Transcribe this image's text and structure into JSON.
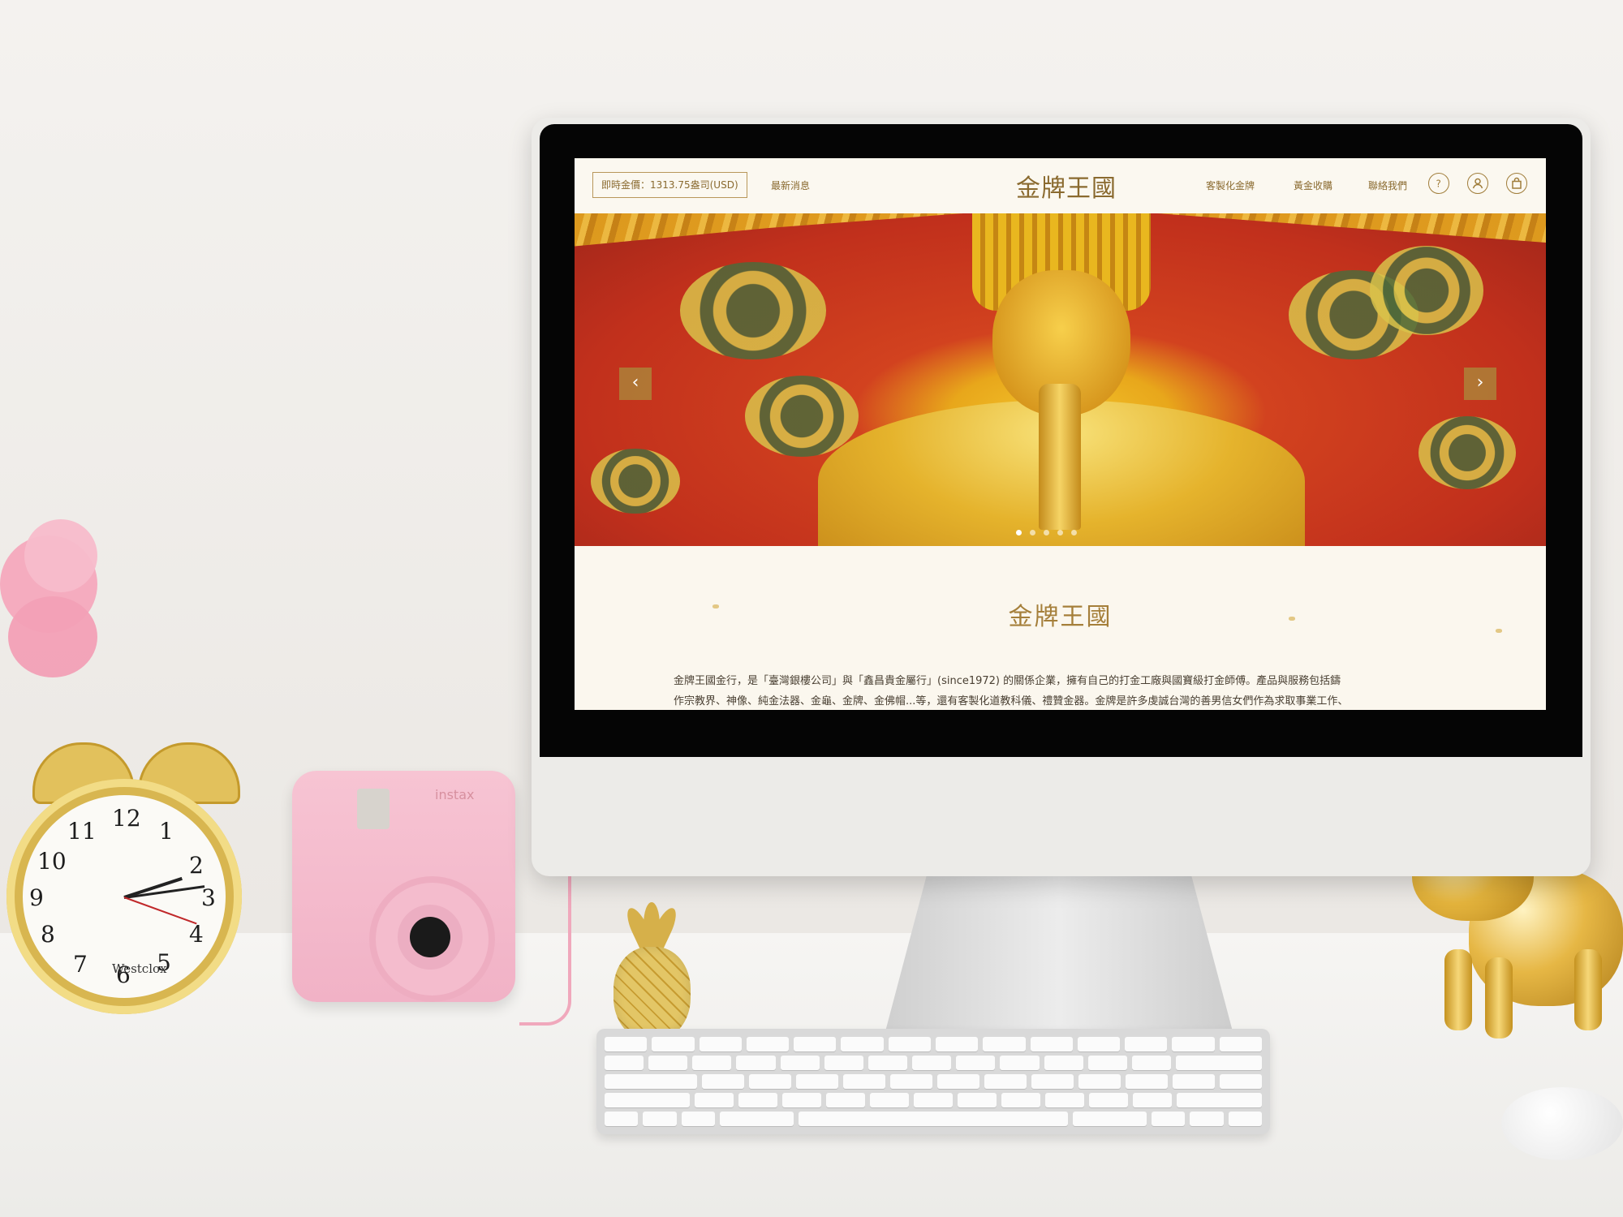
{
  "site": {
    "gold_price_label": "即時金價：1313.75盎司(USD)",
    "nav_left": [
      "最新消息"
    ],
    "logo_text": "金牌王國",
    "nav_right": [
      "客製化金牌",
      "黃金收購",
      "聯絡我們"
    ],
    "icons": [
      "help-icon",
      "user-icon",
      "cart-icon"
    ],
    "hero": {
      "prev_arrow": "‹",
      "next_arrow": "›",
      "slide_count": 5,
      "active_slide": 1
    },
    "section_title": "金牌王國",
    "description_lines": [
      "金牌王國金行，是「臺灣銀樓公司」與「鑫昌貴金屬行」(since1972) 的關係企業，擁有自己的打金工廠與國寶級打金師傅。產品與服務包括鑄",
      "作宗教界、神像、純金法器、金龜、金牌、金佛帽...等，還有客製化道教科儀、禮贊金器。金牌是許多虔誠台灣的善男信女們作為求取事業工作、"
    ]
  },
  "props": {
    "clock_brand": "Westclox",
    "clock_numbers": [
      "12",
      "1",
      "2",
      "3",
      "4",
      "5",
      "6",
      "7",
      "8",
      "9",
      "10",
      "11"
    ],
    "camera_brand": "instax"
  },
  "colors": {
    "accent_gold": "#a57f3a",
    "site_background": "#fbf7ee",
    "wall": "#f0eeea"
  }
}
